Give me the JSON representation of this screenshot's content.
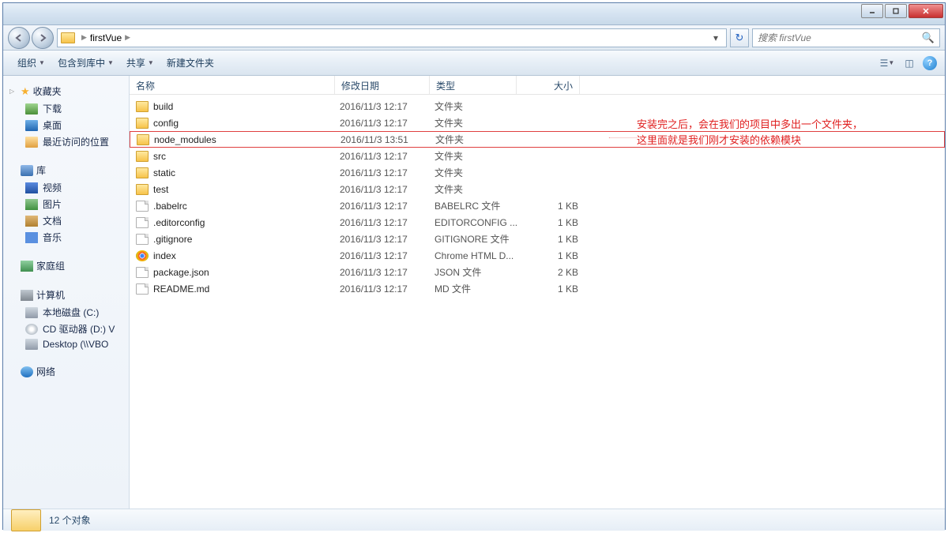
{
  "address": {
    "folder_name": "firstVue"
  },
  "search": {
    "placeholder": "搜索 firstVue"
  },
  "toolbar": {
    "organize": "组织",
    "include": "包含到库中",
    "share": "共享",
    "new_folder": "新建文件夹"
  },
  "sidebar": {
    "favorites": {
      "label": "收藏夹",
      "downloads": "下载",
      "desktop": "桌面",
      "recent": "最近访问的位置"
    },
    "libraries": {
      "label": "库",
      "video": "视频",
      "pictures": "图片",
      "documents": "文档",
      "music": "音乐"
    },
    "homegroup": {
      "label": "家庭组"
    },
    "computer": {
      "label": "计算机",
      "c_drive": "本地磁盘 (C:)",
      "d_drive": "CD 驱动器 (D:) V",
      "desktop_net": "Desktop (\\\\VBO"
    },
    "network": {
      "label": "网络"
    }
  },
  "columns": {
    "name": "名称",
    "date": "修改日期",
    "type": "类型",
    "size": "大小"
  },
  "files": [
    {
      "name": "build",
      "date": "2016/11/3 12:17",
      "type": "文件夹",
      "size": "",
      "icon": "folder"
    },
    {
      "name": "config",
      "date": "2016/11/3 12:17",
      "type": "文件夹",
      "size": "",
      "icon": "folder"
    },
    {
      "name": "node_modules",
      "date": "2016/11/3 13:51",
      "type": "文件夹",
      "size": "",
      "icon": "folder",
      "highlighted": true
    },
    {
      "name": "src",
      "date": "2016/11/3 12:17",
      "type": "文件夹",
      "size": "",
      "icon": "folder"
    },
    {
      "name": "static",
      "date": "2016/11/3 12:17",
      "type": "文件夹",
      "size": "",
      "icon": "folder"
    },
    {
      "name": "test",
      "date": "2016/11/3 12:17",
      "type": "文件夹",
      "size": "",
      "icon": "folder"
    },
    {
      "name": ".babelrc",
      "date": "2016/11/3 12:17",
      "type": "BABELRC 文件",
      "size": "1 KB",
      "icon": "file"
    },
    {
      "name": ".editorconfig",
      "date": "2016/11/3 12:17",
      "type": "EDITORCONFIG ...",
      "size": "1 KB",
      "icon": "file"
    },
    {
      "name": ".gitignore",
      "date": "2016/11/3 12:17",
      "type": "GITIGNORE 文件",
      "size": "1 KB",
      "icon": "file"
    },
    {
      "name": "index",
      "date": "2016/11/3 12:17",
      "type": "Chrome HTML D...",
      "size": "1 KB",
      "icon": "chrome"
    },
    {
      "name": "package.json",
      "date": "2016/11/3 12:17",
      "type": "JSON 文件",
      "size": "2 KB",
      "icon": "file"
    },
    {
      "name": "README.md",
      "date": "2016/11/3 12:17",
      "type": "MD 文件",
      "size": "1 KB",
      "icon": "file"
    }
  ],
  "annotation": {
    "line1": "安装完之后，会在我们的项目中多出一个文件夹，",
    "line2": "这里面就是我们刚才安装的依赖模块"
  },
  "statusbar": {
    "count": "12 个对象"
  }
}
